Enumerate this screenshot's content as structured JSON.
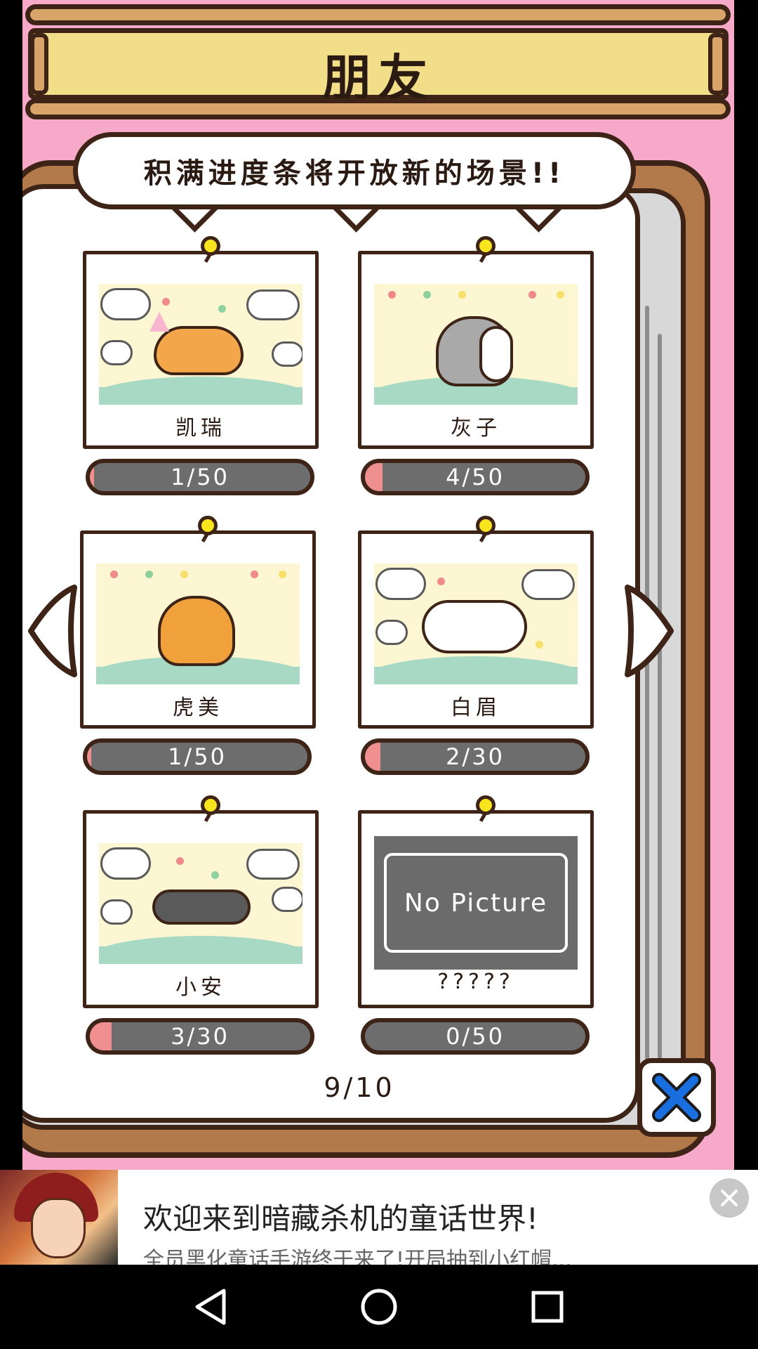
{
  "header": {
    "title": "朋友"
  },
  "hint": {
    "text": "积满进度条将开放新的场景!!"
  },
  "friends": [
    {
      "name": "凯瑞",
      "progress_text": "1/50",
      "progress": 0.02
    },
    {
      "name": "灰子",
      "progress_text": "4/50",
      "progress": 0.08
    },
    {
      "name": "虎美",
      "progress_text": "1/50",
      "progress": 0.02
    },
    {
      "name": "白眉",
      "progress_text": "2/30",
      "progress": 0.07
    },
    {
      "name": "小安",
      "progress_text": "3/30",
      "progress": 0.1
    },
    {
      "name": "?????",
      "progress_text": "0/50",
      "progress": 0.0,
      "placeholder": "No Picture"
    }
  ],
  "pagination": {
    "current": "9/10"
  },
  "icons": {
    "prev": "triangle-left-icon",
    "next": "triangle-right-icon",
    "close": "close-x-icon"
  },
  "colors": {
    "background_pink": "#f7a9c9",
    "book_brown": "#b27a4b",
    "outline": "#3e2317",
    "bar_gray": "#6d6d6d",
    "bar_fill": "#ef8f8f",
    "pin_yellow": "#f8e51e",
    "close_blue": "#1a6fe0"
  },
  "ad": {
    "title": "欢迎来到暗藏杀机的童话世界!",
    "subtitle": "全员黑化童话手游终于来了!开局抽到小红帽..."
  },
  "navbar": {
    "back": "back-triangle-icon",
    "home": "home-circle-icon",
    "recents": "recents-square-icon"
  }
}
